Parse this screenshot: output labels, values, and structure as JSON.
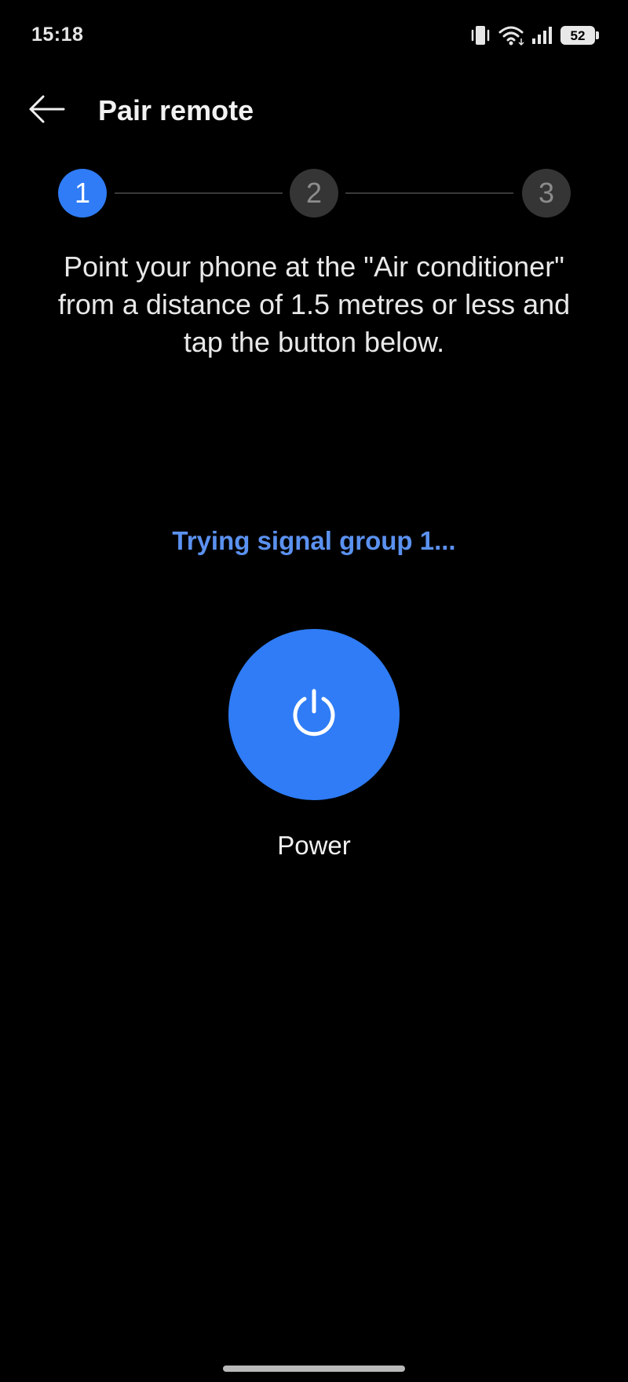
{
  "status_bar": {
    "time": "15:18",
    "battery_level": "52",
    "icons": [
      "vibrate-icon",
      "wifi-icon",
      "signal-icon",
      "battery-icon"
    ]
  },
  "header": {
    "title": "Pair remote",
    "back_icon": "arrow-left-icon"
  },
  "stepper": {
    "steps": [
      {
        "label": "1",
        "state": "active"
      },
      {
        "label": "2",
        "state": "inactive"
      },
      {
        "label": "3",
        "state": "inactive"
      }
    ]
  },
  "instruction": "Point your phone at the \"Air conditioner\" from a distance of 1.5 metres or less and tap the button below.",
  "signal_status": "Trying signal group 1...",
  "power": {
    "label": "Power",
    "icon": "power-icon"
  },
  "colors": {
    "accent": "#2f7cf6",
    "status_text": "#5b91f0",
    "background": "#000000",
    "inactive_step": "#353535"
  }
}
